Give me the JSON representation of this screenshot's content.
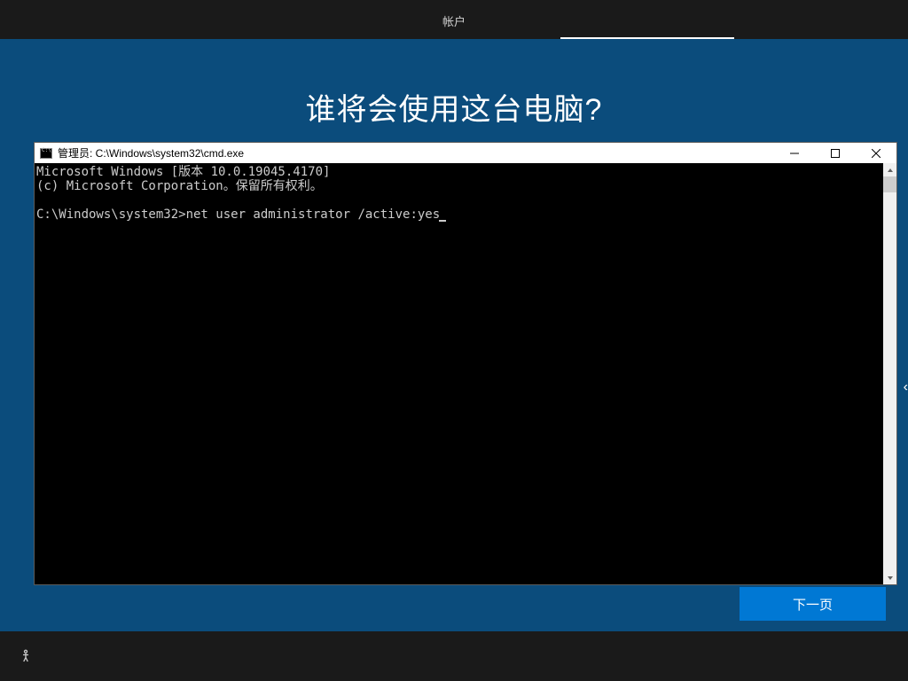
{
  "topbar": {
    "tab_label": "帐户"
  },
  "setup": {
    "title": "谁将会使用这台电脑?",
    "next_button": "下一页"
  },
  "cmd": {
    "title": "管理员: C:\\Windows\\system32\\cmd.exe",
    "line1": "Microsoft Windows [版本 10.0.19045.4170]",
    "line2": "(c) Microsoft Corporation。保留所有权利。",
    "prompt": "C:\\Windows\\system32>",
    "command": "net user administrator /active:yes"
  }
}
